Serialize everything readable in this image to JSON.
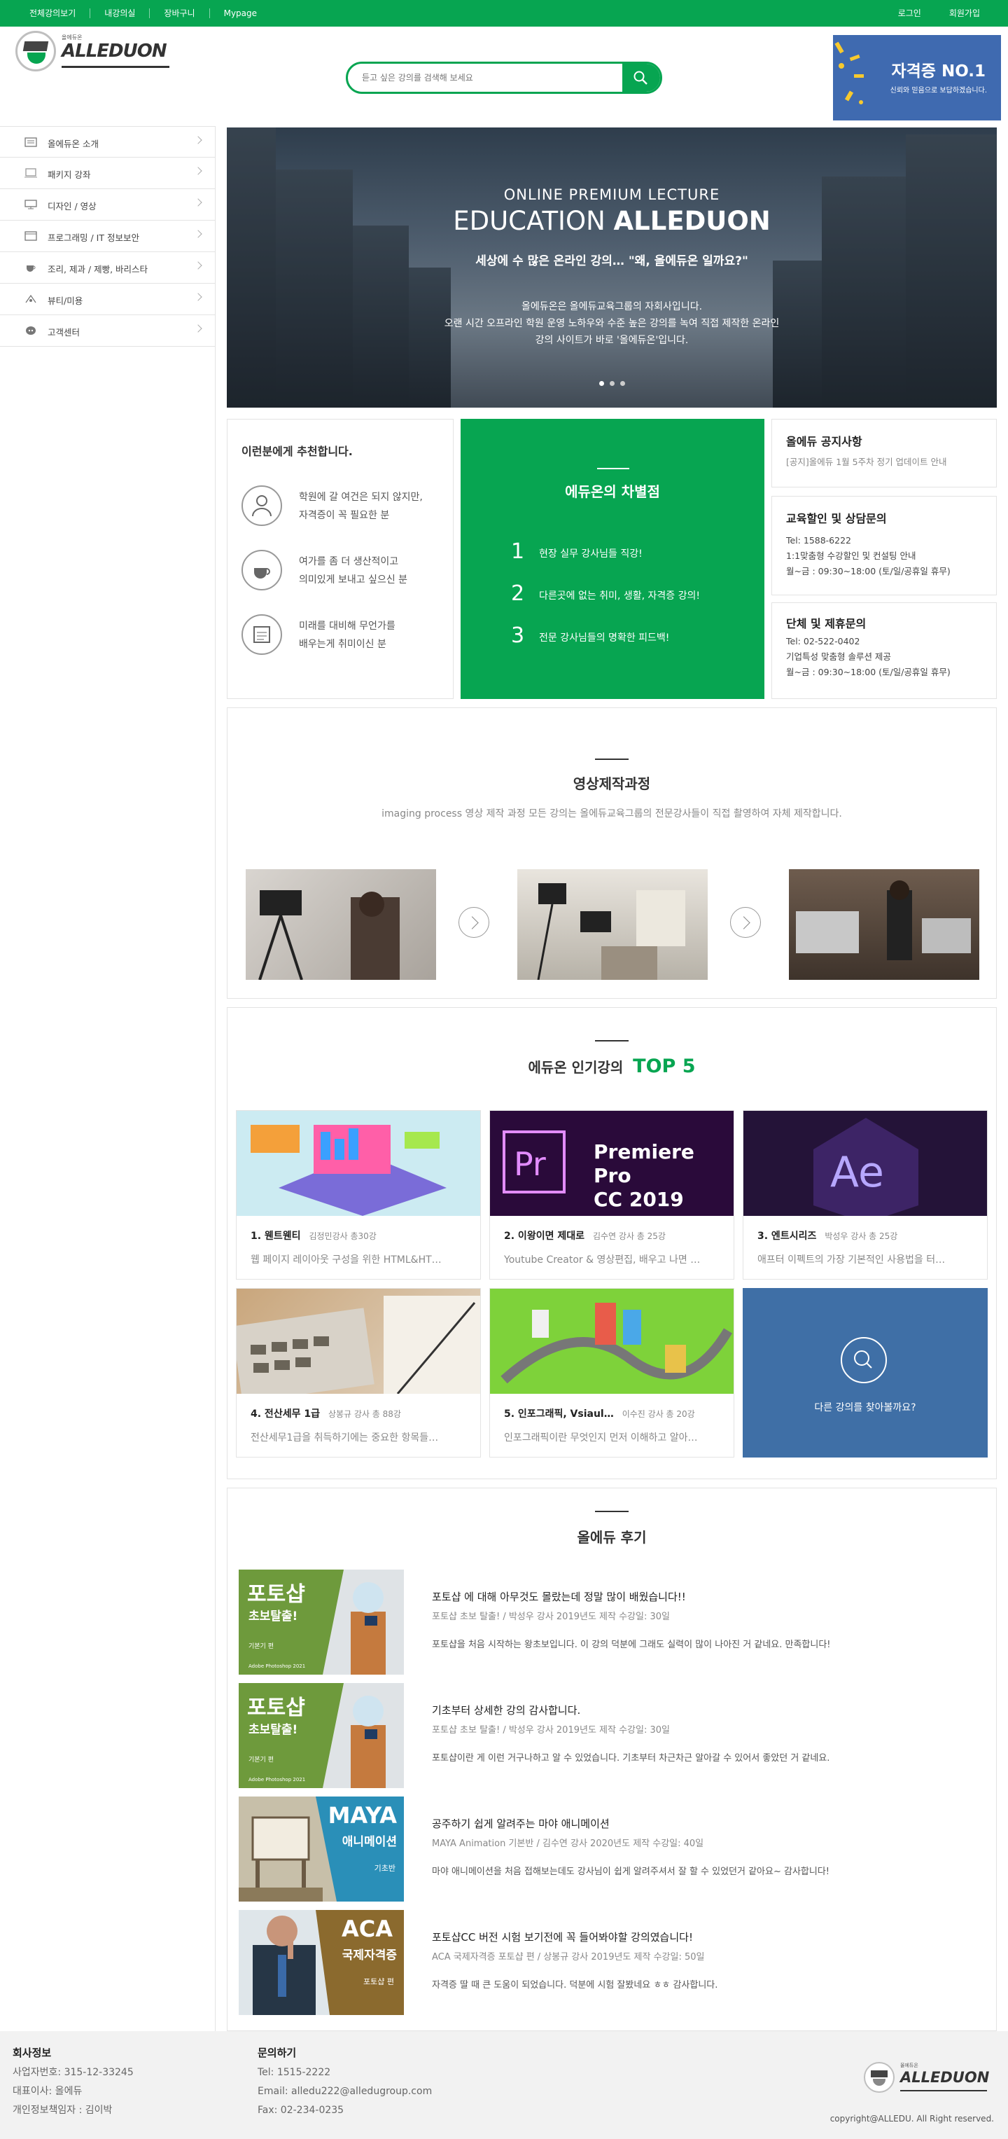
{
  "topbar": {
    "links": [
      "전체강의보기",
      "내강의실",
      "장바구니",
      "Mypage"
    ],
    "login": "로그인",
    "signup": "회원가입"
  },
  "header": {
    "logo_small": "올에듀온",
    "logo_name": "ALLEDUON",
    "search_placeholder": "듣고 싶은 강의를 검색해 보세요",
    "banner_title": "자격증 NO.1",
    "banner_sub": "신뢰와 믿음으로 보답하겠습니다."
  },
  "sidebar": {
    "items": [
      {
        "label": "올에듀온 소개",
        "icon": "book-icon"
      },
      {
        "label": "패키지 강좌",
        "icon": "package-icon"
      },
      {
        "label": "디자인 / 영상",
        "icon": "monitor-icon"
      },
      {
        "label": "프로그래밍 / IT 정보보안",
        "icon": "code-icon"
      },
      {
        "label": "조리, 제과 / 제빵, 바리스타",
        "icon": "cup-icon"
      },
      {
        "label": "뷰티/미용",
        "icon": "beauty-icon"
      },
      {
        "label": "고객센터",
        "icon": "headset-icon"
      }
    ]
  },
  "hero": {
    "line1": "ONLINE PREMIUM LECTURE",
    "line2a": "EDUCATION",
    "line2b": "ALLEDUON",
    "line3": "세상에 수 많은 온라인 강의… \"왜, 올에듀온 일까요?\"",
    "line4": "올에듀온은 올에듀교육그룹의 자회사입니다.",
    "line5": "오랜 시간 오프라인 학원 운영 노하우와 수준 높은 강의를 녹여 직접 제작한 온라인",
    "line6": "강의 사이트가 바로 '올에듀온'입니다."
  },
  "recommend": {
    "title": "이런분에게 추천합니다.",
    "rows": [
      {
        "l1": "학원에 갈 여건은 되지 않지만,",
        "l2": "자격증이 꼭 필요한 분"
      },
      {
        "l1": "여가를 좀 더 생산적이고",
        "l2": "의미있게 보내고 싶으신 분"
      },
      {
        "l1": "미래를 대비해 무언가를",
        "l2": "배우는게 취미이신 분"
      }
    ]
  },
  "diff": {
    "title": "에듀온의 차별점",
    "points": [
      {
        "n": "1",
        "t": "현장 실무 강사님들 직강!"
      },
      {
        "n": "2",
        "t": "다른곳에 없는 취미, 생활, 자격증 강의!"
      },
      {
        "n": "3",
        "t": "전문 강사님들의 명확한 피드백!"
      }
    ]
  },
  "notice": {
    "title": "올에듀 공지사항",
    "text": "[공지]올에듀 1월 5주차 정기 업데이트 안내"
  },
  "discount": {
    "title": "교육할인 및 상담문의",
    "tel": "Tel: 1588-6222",
    "l2": "1:1맞춤형 수강할인 및 컨설팅 안내",
    "l3": "월~금 : 09:30~18:00 (토/일/공휴일 휴무)"
  },
  "group": {
    "title": "단체 및 제휴문의",
    "tel": "Tel: 02-522-0402",
    "l2": "기업특성 맞춤형 솔루션 제공",
    "l3": "월~금 : 09:30~18:00 (토/일/공휴일 휴무)"
  },
  "video": {
    "title": "영상제작과정",
    "sub": "imaging process 영상 제작 과정 모든 강의는 올에듀교육그룹의 전문강사들이 직접 촬영하여 자체 제작합니다."
  },
  "top5": {
    "title_pre": "에듀온 인기강의",
    "title_tag": "TOP 5",
    "cards": [
      {
        "name": "1. 웬트웬티",
        "meta": "김정민강사 총30강",
        "desc": "웹 페이지 레이아웃 구성을 위한 HTML&HT…",
        "art": "web-illustration"
      },
      {
        "name": "2. 이왕이면 제대로",
        "meta": "김수연 강사 총 25강",
        "desc": "Youtube Creator & 영상편집, 배우고 나면 …",
        "art": "premiere-logo"
      },
      {
        "name": "3. 엔트시리즈",
        "meta": "박성우 강사 총 25강",
        "desc": "애프터 이펙트의 가장 기본적인 사용법을 터…",
        "art": "aftereffects-logo"
      },
      {
        "name": "4. 전산세무 1급",
        "meta": "상봉규 강사 총 88강",
        "desc": "전산세무1급을 취득하기에는 중요한 항목들…",
        "art": "calculator-photo"
      },
      {
        "name": "5. 인포그래픽, Vsiaul…",
        "meta": "이수진 강사 총 20강",
        "desc": "인포그래픽이란 무엇인지 먼저 이해하고 알아…",
        "art": "city-infographic"
      }
    ],
    "premiere_l1": "Premiere Pro",
    "premiere_l2": "CC 2019",
    "more_text": "다른 강의를 찾아볼까요?"
  },
  "reviews": {
    "title": "올에듀 후기",
    "items": [
      {
        "title": "포토샵 에 대해 아무것도 몰랐는데 정말 많이 배웠습니다!!",
        "meta": "포토샵 초보 탈출! / 박성우 강사   2019년도 제작   수강일: 30일",
        "body": "포토샵을 처음 시작하는 왕초보입니다. 이 강의 덕분에 그래도 실력이 많이 나아진 거 같네요. 만족합니다!",
        "t1": "포토샵",
        "t2": "초보탈출!",
        "t3": "기본기 편",
        "t4": "Adobe Photoshop 2021",
        "bg": "#6e9a3c"
      },
      {
        "title": "기초부터 상세한 강의 감사합니다.",
        "meta": "포토샵 초보 탈출! / 박성우 강사   2019년도 제작   수강일: 30일",
        "body": "포토샵이란 게 이런 거구나하고 알 수 있었습니다. 기초부터 차근차근 알아갈 수 있어서 좋았던 거 같네요.",
        "t1": "포토샵",
        "t2": "초보탈출!",
        "t3": "기본기 편",
        "t4": "Adobe Photoshop 2021",
        "bg": "#6e9a3c"
      },
      {
        "title": "공주하기 쉽게 알려주는 마야 애니메이션",
        "meta": "MAYA Animation 기본반 / 김수연 강사   2020년도 제작   수강일: 40일",
        "body": "마야 애니메이션을 처음 접해보는데도 강사님이 쉽게 알려주셔서 잘 할 수 있었던거 같아요~ 감사합니다!",
        "t1": "MAYA",
        "t2": "애니메이션",
        "t3": "기초반",
        "t4": "",
        "bg": "#2a8fb8"
      },
      {
        "title": "포토샵CC 버전 시험 보기전에 꼭 들어봐야할 강의였습니다!",
        "meta": "ACA 국제자격증 포토샵 편 / 상봉규 강사   2019년도 제작   수강일: 50일",
        "body": "자격증 딸 때 큰 도움이 되었습니다. 덕분에 시험 잘봤네요 ㅎㅎ 감사합니다.",
        "t1": "ACA",
        "t2": "국제자격증",
        "t3": "포토샵 편",
        "t4": "",
        "bg": "#8b6a2e"
      }
    ]
  },
  "footer": {
    "company_h": "회사정보",
    "c1": "사업자번호: 315-12-33245",
    "c2": "대표이사: 올에듀",
    "c3": "개인정보책임자 : 김이박",
    "contact_h": "문의하기",
    "t1": "Tel: 1515-2222",
    "t2": "Email: alledu222@alledugroup.com",
    "t3": "Fax: 02-234-0235",
    "copy": "copyright@ALLEDU. All Right reserved."
  }
}
